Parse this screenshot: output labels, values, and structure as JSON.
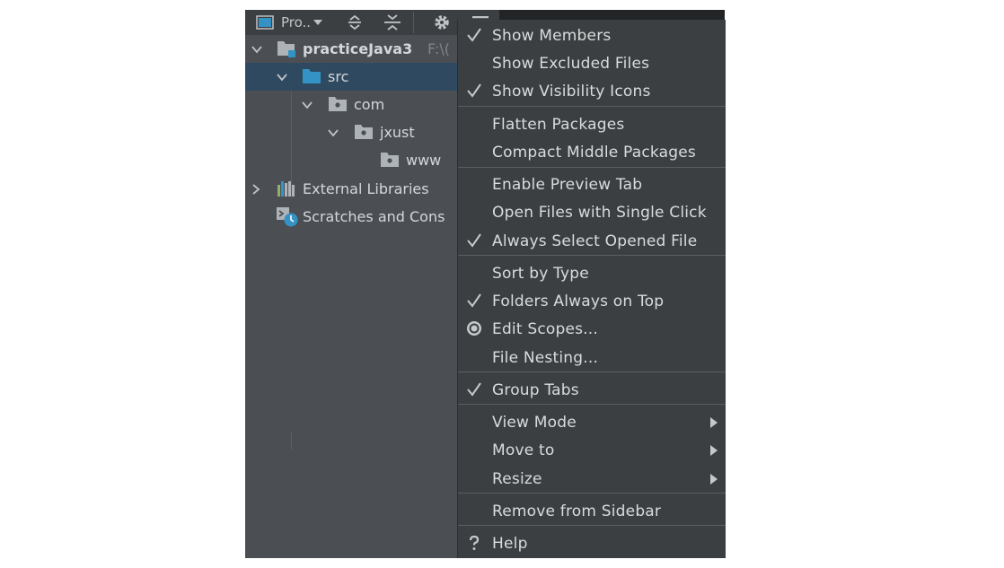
{
  "toolbar": {
    "view_label": "Pro..",
    "icons": [
      "project-window-icon",
      "dropdown-arrow-icon",
      "expand-all-icon",
      "collapse-all-icon",
      "gear-icon",
      "hide-icon"
    ]
  },
  "tree": {
    "project_name": "practiceJava3",
    "project_path": "F:\\(",
    "src": "src",
    "com": "com",
    "jxust": "jxust",
    "www": "www",
    "external_libraries": "External Libraries",
    "scratches": "Scratches and Cons"
  },
  "menu": {
    "show_members": "Show Members",
    "show_excluded_files": "Show Excluded Files",
    "show_visibility_icons": "Show Visibility Icons",
    "flatten_packages": "Flatten Packages",
    "compact_middle_packages": "Compact Middle Packages",
    "enable_preview_tab": "Enable Preview Tab",
    "open_files_single_click": "Open Files with Single Click",
    "always_select_opened_file": "Always Select Opened File",
    "sort_by_type": "Sort by Type",
    "folders_always_on_top": "Folders Always on Top",
    "edit_scopes": "Edit Scopes...",
    "file_nesting": "File Nesting...",
    "group_tabs": "Group Tabs",
    "view_mode": "View Mode",
    "move_to": "Move to",
    "resize": "Resize",
    "remove_from_sidebar": "Remove from Sidebar",
    "help": "Help"
  },
  "colors": {
    "panel_bg": "#4b4f53",
    "menu_bg": "#3c3f41",
    "selection": "#2f4a60",
    "folder_blue": "#3592c4",
    "folder_gray": "#aeb3b7",
    "text": "#d9dbdd"
  }
}
